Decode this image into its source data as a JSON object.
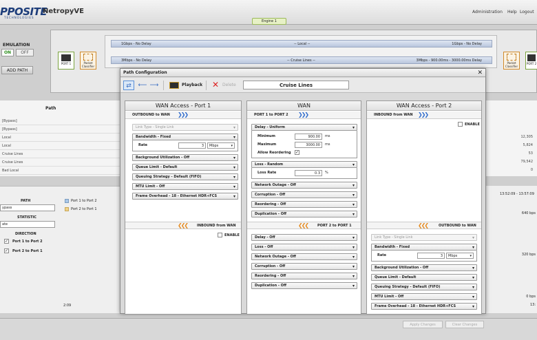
{
  "app": {
    "logo_text": "PPOSITE",
    "logo_sub": "TECHNOLOGIES",
    "name": "NetropyVE",
    "links": [
      "Administration",
      "Help",
      "Logout"
    ],
    "engine_tab": "Engine 1"
  },
  "emulation": {
    "label": "EMULATION",
    "on": "ON",
    "off": "OFF",
    "add_path": "ADD PATH"
  },
  "topology": {
    "port1": "PORT 1",
    "packet_classifier": "Packet Classifier",
    "port2": "PORT 2",
    "bands": [
      {
        "left": "1Gbps - No Delay",
        "center": "-- Local --",
        "right": "1Gbps - No Delay"
      },
      {
        "left": "3Mbps - No Delay",
        "center": "-- Cruise Lines --",
        "right": "3Mbps - 900.00ms - 3000.00ms Delay"
      }
    ]
  },
  "background": {
    "path_header": "Path",
    "rows": [
      "[Bypass]",
      "[Bypass]",
      "Local",
      "Local",
      "Cruise Lines",
      "Cruise Lines",
      "Bad Local"
    ],
    "right_values": [
      "12,305",
      "5,824",
      "53",
      "79,542",
      "0"
    ],
    "bottom": {
      "path_label": "PATH",
      "path_value": "ypass",
      "statistic_label": "STATISTIC",
      "statistic_value": "ate",
      "direction_label": "DIRECTION",
      "dir1": "Port 1 to Port 2",
      "dir2": "Port 2 to Port 1"
    },
    "legend": [
      "Port 1 to Port 2",
      "Port 2 to Port 1"
    ],
    "time_range": "13:52:09 - 13:57:09",
    "y_labels": [
      "640 bps",
      "320 bps",
      "0 bps"
    ],
    "x_start": "2:09",
    "x_end": "13:"
  },
  "dialog": {
    "title": "Path Configuration",
    "close": "✕",
    "playback": "Playback",
    "delete": "Delete",
    "path_name": "Cruise Lines",
    "apply": "Apply Changes",
    "clear": "Clear Changes",
    "wan_port1": {
      "title": "WAN Access - Port 1",
      "outbound": "OUTBOUND to WAN",
      "link_type": "Link Type - Single Link",
      "bandwidth": "Bandwidth - Fixed",
      "rate_label": "Rate",
      "rate_value": "3",
      "rate_unit": "Mbps",
      "items": [
        "Background Utilization - Off",
        "Queue Limit - Default",
        "Queuing Strategy - Default (FIFO)",
        "MTU Limit - Off",
        "Frame Overhead - 18 - Ethernet HDR+FCS"
      ],
      "inbound": "INBOUND from WAN",
      "enable": "ENABLE"
    },
    "wan": {
      "title": "WAN",
      "p1p2": "PORT 1 to PORT 2",
      "delay": "Delay - Uniform",
      "min_label": "Minimum",
      "min_value": "900.00",
      "max_label": "Maximum",
      "max_value": "3000.00",
      "ms": "ms",
      "reorder_label": "Allow Reordering",
      "reorder_checked": "✓",
      "loss": "Loss - Random",
      "loss_rate_label": "Loss Rate",
      "loss_rate_value": "0.3",
      "pct": "%",
      "items": [
        "Network Outage - Off",
        "Corruption - Off",
        "Reordering - Off",
        "Duplication - Off"
      ],
      "p2p1": "PORT 2 to PORT 1",
      "items2": [
        "Delay - Off",
        "Loss - Off",
        "Network Outage - Off",
        "Corruption - Off",
        "Reordering - Off",
        "Duplication - Off"
      ]
    },
    "wan_port2": {
      "title": "WAN Access - Port 2",
      "inbound": "INBOUND from WAN",
      "enable": "ENABLE",
      "outbound": "OUTBOUND to WAN",
      "link_type": "Link Type - Single Link",
      "bandwidth": "Bandwidth - Fixed",
      "rate_label": "Rate",
      "rate_value": "3",
      "rate_unit": "Mbps",
      "items": [
        "Background Utilization - Off",
        "Queue Limit - Default",
        "Queuing Strategy - Default (FIFO)",
        "MTU Limit - Off",
        "Frame Overhead - 18 - Ethernet HDR+FCS"
      ]
    }
  }
}
